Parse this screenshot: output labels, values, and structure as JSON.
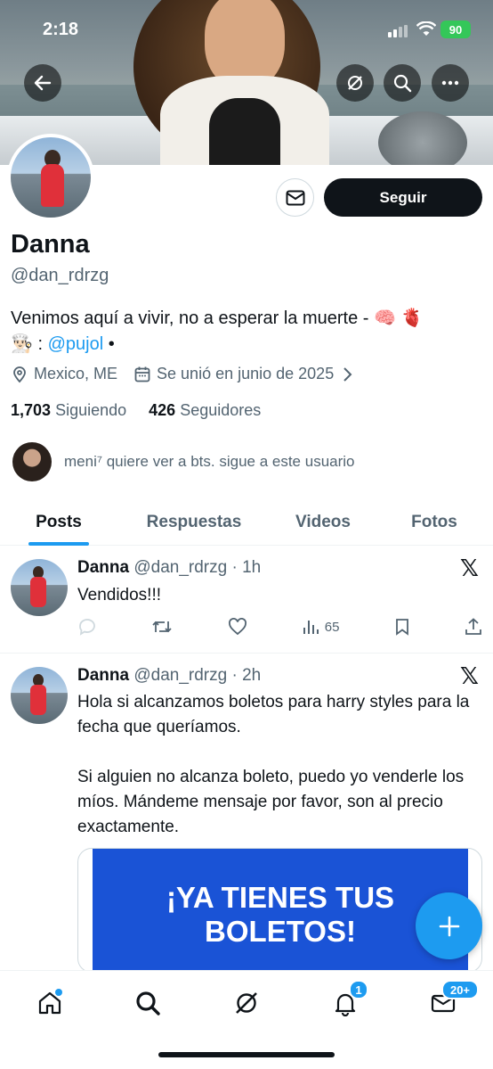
{
  "status_bar": {
    "time": "2:18",
    "battery": "90"
  },
  "profile": {
    "name": "Danna",
    "handle": "@dan_rdrzg",
    "follow_label": "Seguir",
    "bio_text": "Venimos aquí a vivir, no a esperar la muerte - 🧠 🫀",
    "bio_line2_prefix": "👨🏻‍🍳 : ",
    "bio_link": "@pujol",
    "bio_suffix": " •",
    "location": "Mexico, ME",
    "joined": "Se unió en junio de 2025",
    "following_count": "1,703",
    "following_label": "Siguiendo",
    "followers_count": "426",
    "followers_label": "Seguidores",
    "mutual_text": "meni⁷ quiere ver a bts. sigue a este usuario"
  },
  "tabs": [
    {
      "label": "Posts"
    },
    {
      "label": "Respuestas"
    },
    {
      "label": "Videos"
    },
    {
      "label": "Fotos"
    }
  ],
  "posts": [
    {
      "author": "Danna",
      "handle": "@dan_rdrzg",
      "time": "· 1h",
      "text": "Vendidos!!!",
      "views": "65"
    },
    {
      "author": "Danna",
      "handle": "@dan_rdrzg",
      "time": "· 2h",
      "text_p1": "Hola si alcanzamos boletos para harry styles para la fecha que queríamos.",
      "text_p2": "Si alguien no alcanza boleto, puedo yo venderle los míos. Mándeme mensaje por favor, son al precio exactamente.",
      "card_text": "¡YA TIENES TUS BOLETOS!"
    }
  ],
  "nav": {
    "notifications_badge": "1",
    "messages_badge": "20+"
  },
  "colors": {
    "accent": "#1d9bf0",
    "text": "#0f1419",
    "secondary": "#536471",
    "card_blue": "#1a53d6"
  }
}
